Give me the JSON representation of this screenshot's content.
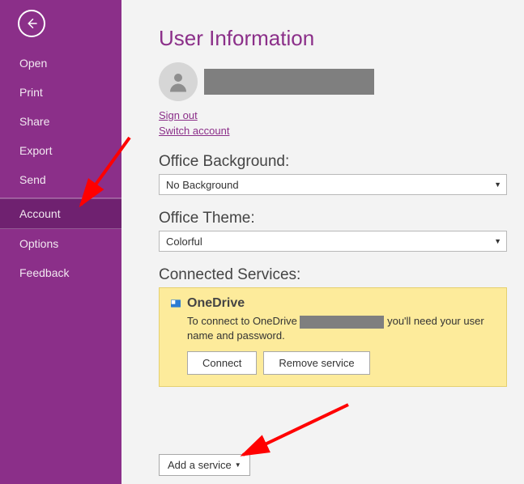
{
  "sidebar": {
    "items": [
      {
        "label": "Open"
      },
      {
        "label": "Print"
      },
      {
        "label": "Share"
      },
      {
        "label": "Export"
      },
      {
        "label": "Send"
      },
      {
        "label": "Account"
      },
      {
        "label": "Options"
      },
      {
        "label": "Feedback"
      }
    ]
  },
  "main": {
    "title": "User Information",
    "sign_out": "Sign out",
    "switch_account": "Switch account",
    "bg_label": "Office Background:",
    "bg_value": "No Background",
    "theme_label": "Office Theme:",
    "theme_value": "Colorful",
    "services_label": "Connected Services:",
    "onedrive": {
      "name": "OneDrive",
      "text_pre": "To connect to OneDrive",
      "text_post": " you'll need your user name and password.",
      "connect": "Connect",
      "remove": "Remove service"
    },
    "add_service": "Add a service"
  }
}
